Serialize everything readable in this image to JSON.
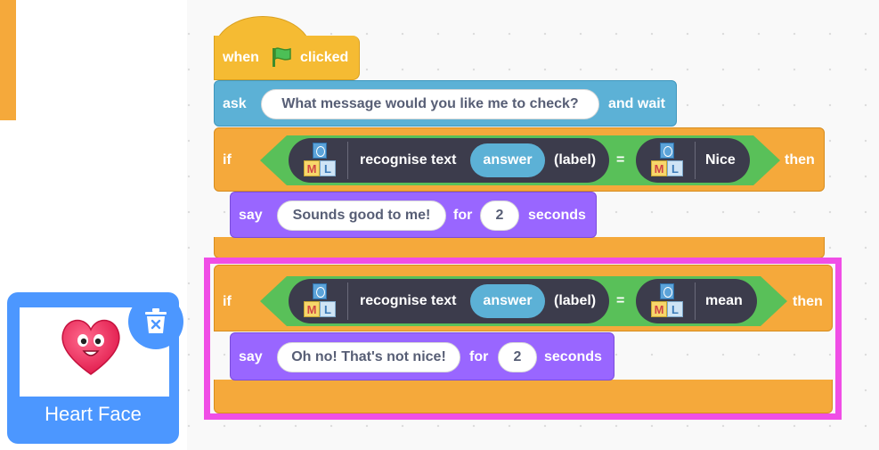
{
  "colors": {
    "events": "#f5bb33",
    "control": "#f5a93b",
    "sensing": "#5cb1d6",
    "looks": "#9966ff",
    "operator": "#59c059",
    "ml_reporter": "#3c3c4c",
    "highlight": "#f04ee6",
    "sprite_selected": "#4c97ff"
  },
  "script": {
    "hat": {
      "when": "when",
      "icon": "green-flag-icon",
      "clicked": "clicked"
    },
    "ask": {
      "keyword": "ask",
      "question": "What message would you like me to check?",
      "and_wait": "and wait"
    },
    "if1": {
      "keyword": "if",
      "reporter": {
        "label": "recognise text",
        "input": "answer",
        "suffix": "(label)"
      },
      "equals": "=",
      "value": "Nice",
      "then": "then",
      "say": {
        "keyword": "say",
        "message": "Sounds good to me!",
        "for": "for",
        "seconds_value": "2",
        "seconds": "seconds"
      }
    },
    "if2": {
      "keyword": "if",
      "reporter": {
        "label": "recognise text",
        "input": "answer",
        "suffix": "(label)"
      },
      "equals": "=",
      "value": "mean",
      "then": "then",
      "say": {
        "keyword": "say",
        "message": "Oh no! That's not nice!",
        "for": "for",
        "seconds_value": "2",
        "seconds": "seconds"
      }
    },
    "ml_icon": {
      "m": "M",
      "l": "L"
    }
  },
  "sprite": {
    "name": "Heart Face",
    "icon": "heart-face-icon",
    "delete_icon": "trash-icon"
  }
}
